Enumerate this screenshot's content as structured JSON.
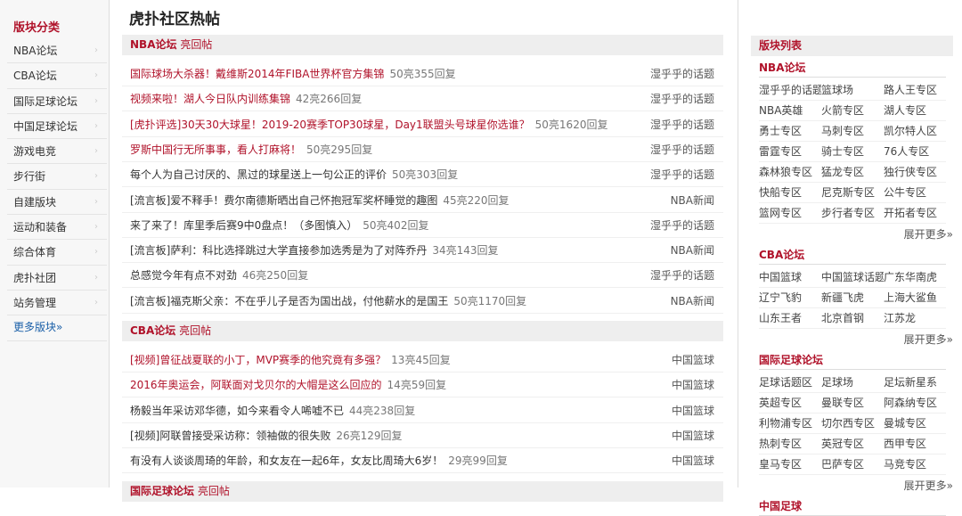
{
  "sidebar": {
    "title": "版块分类",
    "items": [
      "NBA论坛",
      "CBA论坛",
      "国际足球论坛",
      "中国足球论坛",
      "游戏电竞",
      "步行街",
      "自建版块",
      "运动和装备",
      "综合体育",
      "虎扑社团",
      "站务管理"
    ],
    "more": "更多版块»"
  },
  "main": {
    "title": "虎扑社区热帖",
    "sections": [
      {
        "forum": "NBA论坛",
        "label": "亮回帖",
        "posts": [
          {
            "title": "国际球场大杀器！戴维斯2014年FIBA世界杯官方集锦",
            "count": "50亮355回复",
            "source": "湿乎乎的话题",
            "red": true
          },
          {
            "title": "视频来啦！湖人今日队内训练集锦",
            "count": "42亮266回复",
            "source": "湿乎乎的话题",
            "red": true
          },
          {
            "title": "[虎扑评选]30天30大球星！2019-20赛季TOP30球星，Day1联盟头号球星你选谁？",
            "count": "50亮1620回复",
            "source": "湿乎乎的话题",
            "red": true
          },
          {
            "title": "罗斯中国行无所事事，看人打麻将！",
            "count": "50亮295回复",
            "source": "湿乎乎的话题",
            "red": true
          },
          {
            "title": "每个人为自己讨厌的、黑过的球星送上一句公正的评价",
            "count": "50亮303回复",
            "source": "湿乎乎的话题",
            "red": false
          },
          {
            "title": "[流言板]爱不释手！费尔南德斯晒出自己怀抱冠军奖杯睡觉的趣图",
            "count": "45亮220回复",
            "source": "NBA新闻",
            "red": false
          },
          {
            "title": "来了来了！库里季后赛9中0盘点！（多图慎入）",
            "count": "50亮402回复",
            "source": "湿乎乎的话题",
            "red": false
          },
          {
            "title": "[流言板]萨利：科比选择跳过大学直接参加选秀是为了对阵乔丹",
            "count": "34亮143回复",
            "source": "NBA新闻",
            "red": false
          },
          {
            "title": "总感觉今年有点不对劲",
            "count": "46亮250回复",
            "source": "湿乎乎的话题",
            "red": false
          },
          {
            "title": "[流言板]福克斯父亲：不在乎儿子是否为国出战，付他薪水的是国王",
            "count": "50亮1170回复",
            "source": "NBA新闻",
            "red": false
          }
        ]
      },
      {
        "forum": "CBA论坛",
        "label": "亮回帖",
        "posts": [
          {
            "title": "[视频]曾征战夏联的小丁，MVP赛季的他究竟有多强？",
            "count": "13亮45回复",
            "source": "中国篮球",
            "red": true
          },
          {
            "title": "2016年奥运会，阿联面对戈贝尔的大帽是这么回应的",
            "count": "14亮59回复",
            "source": "中国篮球",
            "red": true
          },
          {
            "title": "杨毅当年采访邓华德，如今来看令人唏嘘不已",
            "count": "44亮238回复",
            "source": "中国篮球",
            "red": false
          },
          {
            "title": "[视频]阿联曾接受采访称：领袖做的很失败",
            "count": "26亮129回复",
            "source": "中国篮球",
            "red": false
          },
          {
            "title": "有没有人谈谈周琦的年龄，和女友在一起6年，女友比周琦大6岁！",
            "count": "29亮99回复",
            "source": "中国篮球",
            "red": false
          }
        ]
      },
      {
        "forum": "国际足球论坛",
        "label": "亮回帖",
        "posts": []
      }
    ]
  },
  "right": {
    "title": "版块列表",
    "expand": "展开更多»",
    "forums": [
      {
        "name": "NBA论坛",
        "boards": [
          "湿乎乎的话题",
          "篮球场",
          "路人王专区",
          "NBA英雄",
          "火箭专区",
          "湖人专区",
          "勇士专区",
          "马刺专区",
          "凯尔特人区",
          "雷霆专区",
          "骑士专区",
          "76人专区",
          "森林狼专区",
          "猛龙专区",
          "独行侠专区",
          "快船专区",
          "尼克斯专区",
          "公牛专区",
          "篮网专区",
          "步行者专区",
          "开拓者专区"
        ]
      },
      {
        "name": "CBA论坛",
        "boards": [
          "中国篮球",
          "中国篮球话题",
          "广东华南虎",
          "辽宁飞豹",
          "新疆飞虎",
          "上海大鲨鱼",
          "山东王者",
          "北京首钢",
          "江苏龙"
        ]
      },
      {
        "name": "国际足球论坛",
        "boards": [
          "足球话题区",
          "足球场",
          "足坛新星系",
          "英超专区",
          "曼联专区",
          "阿森纳专区",
          "利物浦专区",
          "切尔西专区",
          "曼城专区",
          "热刺专区",
          "英冠专区",
          "西甲专区",
          "皇马专区",
          "巴萨专区",
          "马竞专区"
        ]
      },
      {
        "name": "中国足球",
        "boards": []
      }
    ]
  },
  "colors": {
    "accent": "#b0122a",
    "link": "#1a5fa8"
  }
}
